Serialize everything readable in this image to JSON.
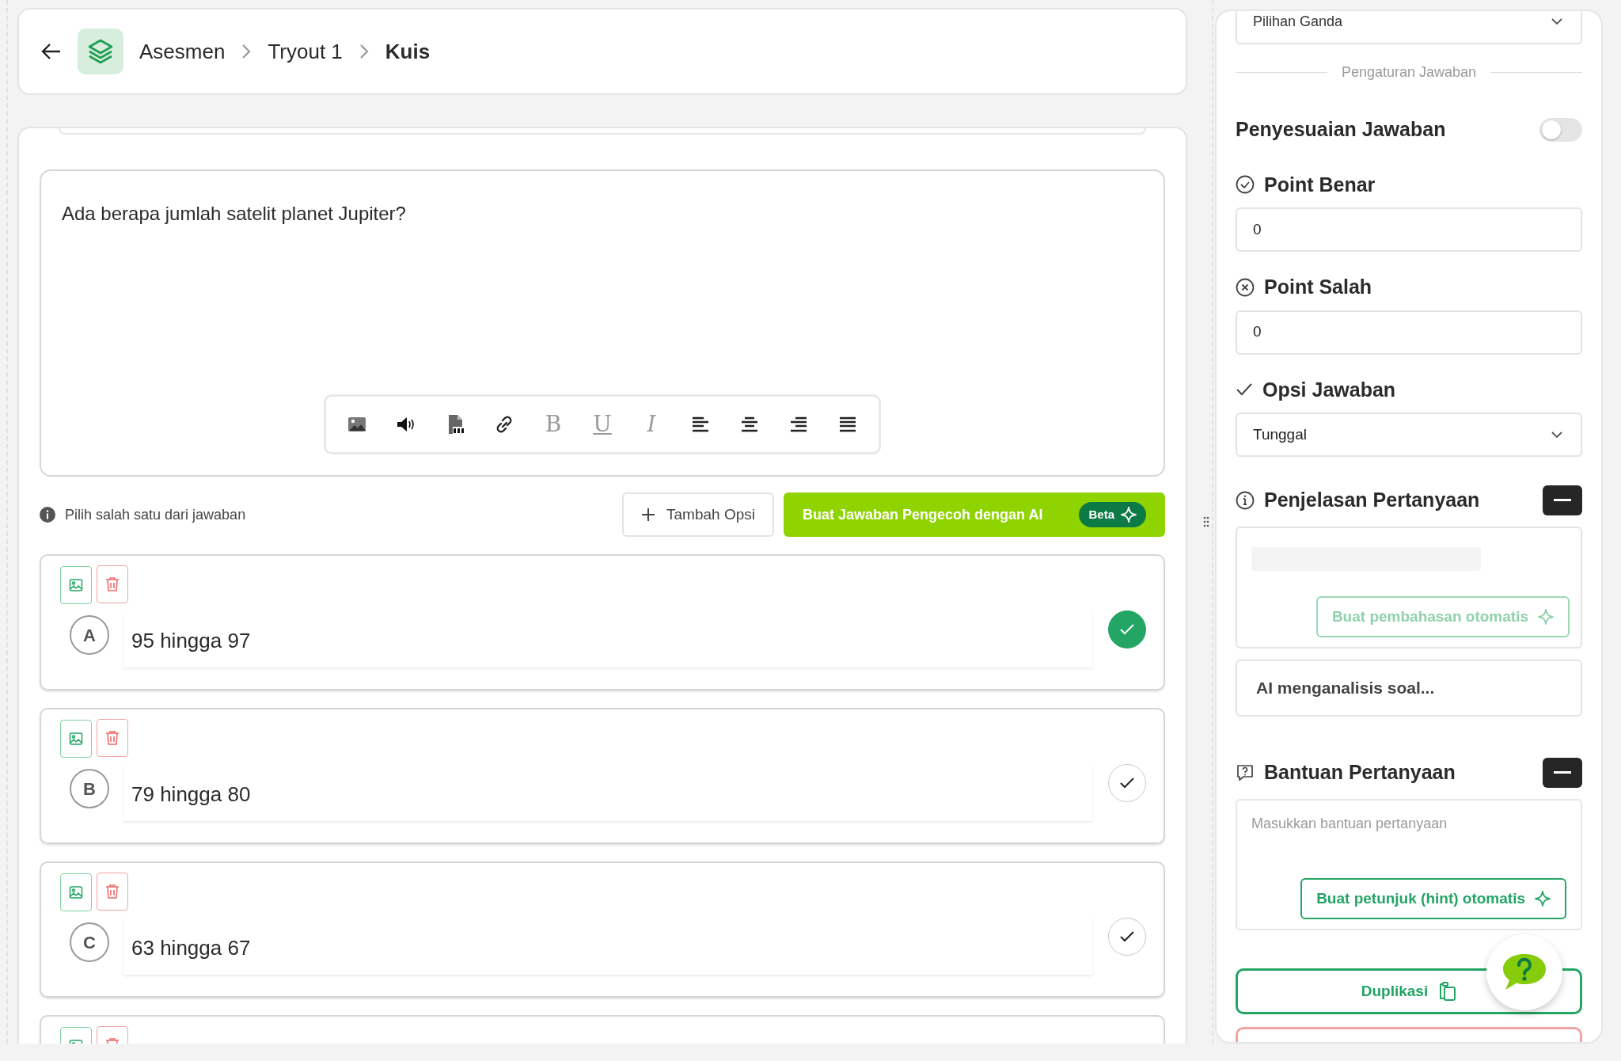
{
  "breadcrumb": [
    {
      "label": "Asesmen",
      "current": false
    },
    {
      "label": "Tryout 1",
      "current": false
    },
    {
      "label": "Kuis",
      "current": true
    }
  ],
  "question": {
    "text": "Ada berapa jumlah satelit planet Jupiter?"
  },
  "toolbar": [
    {
      "kind": "image"
    },
    {
      "kind": "audio"
    },
    {
      "kind": "pdf"
    },
    {
      "kind": "link"
    },
    {
      "kind": "bold",
      "glyph": "B"
    },
    {
      "kind": "underline",
      "glyph": "U"
    },
    {
      "kind": "italic",
      "glyph": "I"
    },
    {
      "kind": "align-left"
    },
    {
      "kind": "align-center"
    },
    {
      "kind": "align-right"
    },
    {
      "kind": "justify"
    }
  ],
  "hint": "Pilih salah satu dari jawaban",
  "add_option_button": "Tambah Opsi",
  "ai_button": {
    "label": "Buat Jawaban Pengecoh dengan AI",
    "badge": "Beta"
  },
  "options": [
    {
      "letter": "A",
      "text": "95 hingga 97",
      "selected": true
    },
    {
      "letter": "B",
      "text": "79 hingga 80",
      "selected": false
    },
    {
      "letter": "C",
      "text": "63 hingga 67",
      "selected": false
    }
  ],
  "more_options_below": true,
  "settings": {
    "question_type": "Pilihan Ganda",
    "section_title": "Pengaturan Jawaban",
    "answer_adjustment": {
      "label": "Penyesuaian Jawaban",
      "on": false
    },
    "correct_points": {
      "label": "Point Benar",
      "value": "0"
    },
    "wrong_points": {
      "label": "Point Salah",
      "value": "0"
    },
    "answer_option": {
      "label": "Opsi Jawaban",
      "value": "Tunggal"
    },
    "explanation": {
      "label": "Penjelasan Pertanyaan",
      "expanded": true,
      "loading": true,
      "button": "Buat pembahasan otomatis",
      "button_disabled": true,
      "status": "AI menganalisis soal..."
    },
    "help": {
      "label": "Bantuan Pertanyaan",
      "expanded": true,
      "placeholder": "Masukkan bantuan pertanyaan",
      "button": "Buat petunjuk (hint) otomatis"
    },
    "actions": [
      {
        "kind": "duplicate",
        "label": "Duplikasi"
      },
      {
        "kind": "delete"
      }
    ]
  }
}
